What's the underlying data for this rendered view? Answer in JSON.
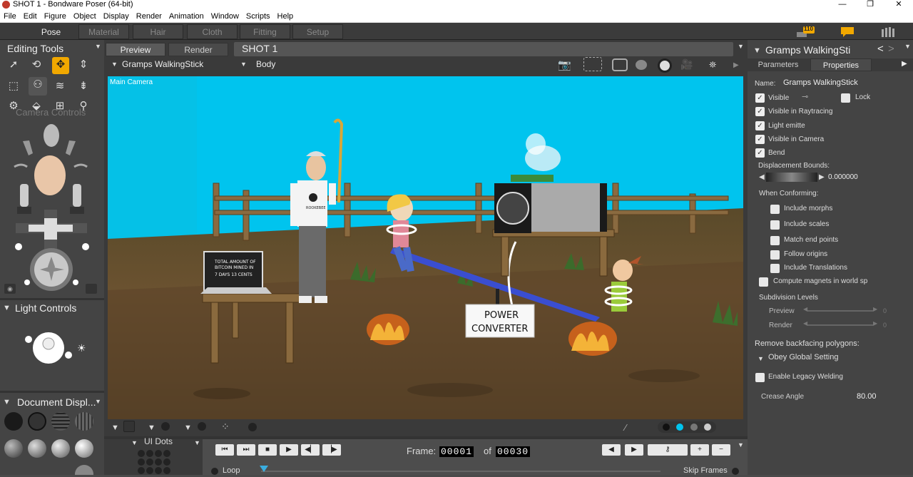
{
  "window": {
    "title": "SHOT 1 - Bondware Poser (64-bit)",
    "minimize": "—",
    "maximize": "❐",
    "close": "✕"
  },
  "menu": [
    "File",
    "Edit",
    "Figure",
    "Object",
    "Display",
    "Render",
    "Animation",
    "Window",
    "Scripts",
    "Help"
  ],
  "rooms": [
    "Pose",
    "Material",
    "Hair",
    "Cloth",
    "Fitting",
    "Setup"
  ],
  "notifications": {
    "badge_count": "110"
  },
  "left": {
    "editing_tools": "Editing Tools",
    "camera_controls": "Camera Controls",
    "light_controls": "Light Controls",
    "document_display": "Document  Displ...",
    "ui_dots": "UI Dots"
  },
  "viewport": {
    "tabs": [
      "Preview",
      "Render"
    ],
    "doc_title": "SHOT 1",
    "figure_select": "Gramps WalkingStick",
    "actor_select": "Body",
    "camera_label": "Main Camera",
    "laptop_text": [
      "TOTAL AMOUNT OF",
      "BITCOIN MINED IN",
      "7 DAYS   13 CENTS"
    ],
    "box_text": [
      "POWER",
      "CONVERTER"
    ],
    "shirt_text": "ROOKEBEE"
  },
  "animation": {
    "frame_label": "Frame:",
    "frame_current": "00001",
    "of_label": "of",
    "frame_total": "00030",
    "loop_label": "Loop",
    "skip_frames_label": "Skip Frames"
  },
  "right": {
    "title": "Gramps WalkingSti",
    "tabs": [
      "Parameters",
      "Properties"
    ],
    "name_label": "Name:",
    "name_value": "Gramps WalkingStick",
    "props": [
      {
        "label": "Visible",
        "checked": true
      },
      {
        "label": "Visible in Raytracing",
        "checked": true
      },
      {
        "label": "Light emitte",
        "checked": true
      },
      {
        "label": "Visible in Camera",
        "checked": true
      },
      {
        "label": "Bend",
        "checked": true
      }
    ],
    "lock_label": "Lock",
    "displacement_label": "Displacement Bounds:",
    "displacement_value": "0.000000",
    "when_conforming": "When Conforming:",
    "conform_opts": [
      "Include morphs",
      "Include scales",
      "Match end points",
      "Follow origins",
      "Include Translations"
    ],
    "compute_magnets": "Compute magnets in world sp",
    "subdivision": "Subdivision Levels",
    "preview_label": "Preview",
    "render_label": "Render",
    "preview_value": "0",
    "render_value": "0",
    "remove_backfacing": "Remove backfacing polygons:",
    "obey_global": "Obey Global Setting",
    "legacy_welding": "Enable Legacy Welding",
    "crease_angle_label": "Crease Angle",
    "crease_angle_value": "80.00"
  },
  "colors": {
    "accent": "#f1a800",
    "sky": "#00c4ee",
    "panel": "#444444"
  }
}
